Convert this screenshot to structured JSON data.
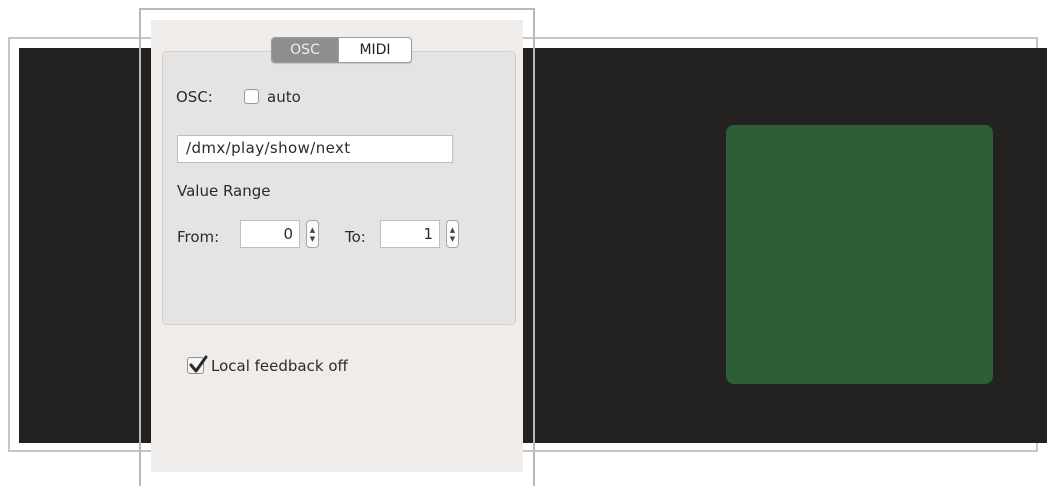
{
  "tabs": {
    "active": "OSC",
    "inactive": "MIDI"
  },
  "osc": {
    "label": "OSC:",
    "auto_label": "auto",
    "auto_checked": false,
    "address_value": "/dmx/play/show/next"
  },
  "range": {
    "title": "Value Range",
    "from_label": "From:",
    "from_value": "0",
    "to_label": "To:",
    "to_value": "1"
  },
  "feedback": {
    "label": "Local feedback off",
    "checked": true
  },
  "colors": {
    "canvas": "#232221",
    "pad": "#2e5e37",
    "panel": "#f0ecea"
  },
  "icons": {
    "stepper_up": "chevron-up-icon",
    "stepper_down": "chevron-down-icon",
    "checkmark": "checkmark-icon"
  }
}
